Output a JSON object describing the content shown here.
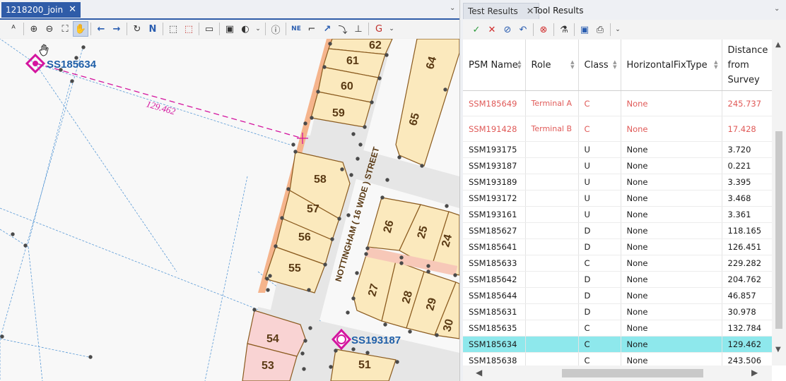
{
  "left": {
    "tab_title": "1218200_join",
    "tab_close": "✕",
    "dropdown": "⌄"
  },
  "map": {
    "survey_points": [
      {
        "label": "SS185634"
      },
      {
        "label": "SS193187"
      }
    ],
    "distance_label": "129.462",
    "street_label": "NOTTINGHAM ( 16 WIDE ) STREET",
    "lots": [
      "62",
      "61",
      "60",
      "59",
      "64",
      "65",
      "58",
      "57",
      "56",
      "55",
      "26",
      "25",
      "24",
      "27",
      "28",
      "29",
      "30",
      "54",
      "53",
      "51"
    ],
    "colors": {
      "lot_fill": "#fbe9bd",
      "lot_edge": "#8a5a1e",
      "road": "#e3e3e3",
      "pink_lot": "#f9d3d3",
      "survey": "#d4159f",
      "label_blue": "#1f5fa8",
      "line_blue": "#5a9ad6"
    }
  },
  "right": {
    "tabs": [
      {
        "label": "Test Results",
        "active": true
      },
      {
        "label": "Tool Results",
        "active": false
      }
    ],
    "tab_close": "✕",
    "dropdown": "⌄",
    "columns": [
      "PSM Name",
      "Role",
      "Class",
      "HorizontalFixType",
      "Distance from Survey"
    ],
    "rows": [
      {
        "name": "SSM185649",
        "role": "Terminal A",
        "class": "C",
        "fix": "None",
        "dist": "245.737",
        "status": "error"
      },
      {
        "name": "SSM191428",
        "role": "Terminal B",
        "class": "C",
        "fix": "None",
        "dist": "17.428",
        "status": "error"
      },
      {
        "name": "SSM193175",
        "role": "",
        "class": "U",
        "fix": "None",
        "dist": "3.720",
        "status": "normal"
      },
      {
        "name": "SSM193187",
        "role": "",
        "class": "U",
        "fix": "None",
        "dist": "0.221",
        "status": "normal"
      },
      {
        "name": "SSM193189",
        "role": "",
        "class": "U",
        "fix": "None",
        "dist": "3.395",
        "status": "normal"
      },
      {
        "name": "SSM193172",
        "role": "",
        "class": "U",
        "fix": "None",
        "dist": "3.468",
        "status": "normal"
      },
      {
        "name": "SSM193161",
        "role": "",
        "class": "U",
        "fix": "None",
        "dist": "3.361",
        "status": "normal"
      },
      {
        "name": "SSM185627",
        "role": "",
        "class": "D",
        "fix": "None",
        "dist": "118.165",
        "status": "normal"
      },
      {
        "name": "SSM185641",
        "role": "",
        "class": "D",
        "fix": "None",
        "dist": "126.451",
        "status": "normal"
      },
      {
        "name": "SSM185633",
        "role": "",
        "class": "C",
        "fix": "None",
        "dist": "229.282",
        "status": "normal"
      },
      {
        "name": "SSM185642",
        "role": "",
        "class": "D",
        "fix": "None",
        "dist": "204.762",
        "status": "normal"
      },
      {
        "name": "SSM185644",
        "role": "",
        "class": "D",
        "fix": "None",
        "dist": "46.857",
        "status": "normal"
      },
      {
        "name": "SSM185631",
        "role": "",
        "class": "D",
        "fix": "None",
        "dist": "30.978",
        "status": "normal"
      },
      {
        "name": "SSM185635",
        "role": "",
        "class": "C",
        "fix": "None",
        "dist": "132.784",
        "status": "normal"
      },
      {
        "name": "SSM185634",
        "role": "",
        "class": "C",
        "fix": "None",
        "dist": "129.462",
        "status": "selected"
      },
      {
        "name": "SSM185638",
        "role": "",
        "class": "C",
        "fix": "None",
        "dist": "243.506",
        "status": "normal"
      }
    ],
    "colors": {
      "error_text": "#e05a58",
      "selected_row": "#8ee8ec"
    }
  }
}
